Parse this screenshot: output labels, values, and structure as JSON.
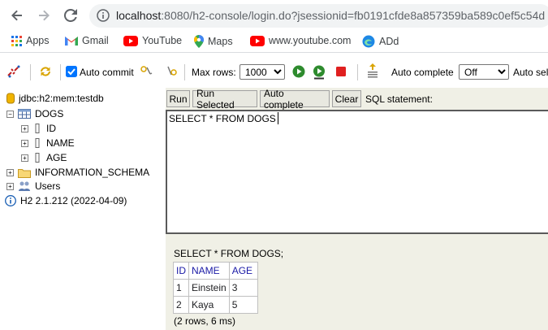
{
  "browser": {
    "url_host": "localhost",
    "url_rest": ":8080/h2-console/login.do?jsessionid=fb0191cfde8a857359ba589c0ef5c54d",
    "bookmarks": [
      {
        "label": "Apps",
        "icon": "apps-grid-icon"
      },
      {
        "label": "Gmail",
        "icon": "gmail-icon"
      },
      {
        "label": "YouTube",
        "icon": "youtube-icon"
      },
      {
        "label": "Maps",
        "icon": "maps-pin-icon"
      },
      {
        "label": "www.youtube.com",
        "icon": "youtube-icon"
      },
      {
        "label": "ADd",
        "icon": "edge-icon"
      }
    ]
  },
  "toolbar": {
    "auto_commit_label": "Auto commit",
    "auto_commit_checked": true,
    "max_rows_label": "Max rows:",
    "max_rows_value": "1000",
    "auto_complete_label": "Auto complete",
    "auto_complete_value": "Off",
    "auto_select_label": "Auto sel"
  },
  "tree": {
    "connection": "jdbc:h2:mem:testdb",
    "table": "DOGS",
    "columns": [
      "ID",
      "NAME",
      "AGE"
    ],
    "schema": "INFORMATION_SCHEMA",
    "users": "Users",
    "version": "H2 2.1.212 (2022-04-09)"
  },
  "query": {
    "buttons": {
      "run": "Run",
      "run_selected": "Run Selected",
      "auto_complete": "Auto complete",
      "clear": "Clear"
    },
    "sql_label": "SQL statement:",
    "sql_text": "SELECT * FROM DOGS"
  },
  "result": {
    "statement": "SELECT * FROM DOGS;",
    "headers": [
      "ID",
      "NAME",
      "AGE"
    ],
    "rows": [
      [
        "1",
        "Einstein",
        "3"
      ],
      [
        "2",
        "Kaya",
        "5"
      ]
    ],
    "summary": "(2 rows, 6 ms)"
  },
  "colors": {
    "header_link": "#1a1aa6",
    "pane_bg": "#f0f0e6",
    "youtube_red": "#ff0000",
    "run_green": "#2e8b2e",
    "stop_red": "#e02020"
  }
}
